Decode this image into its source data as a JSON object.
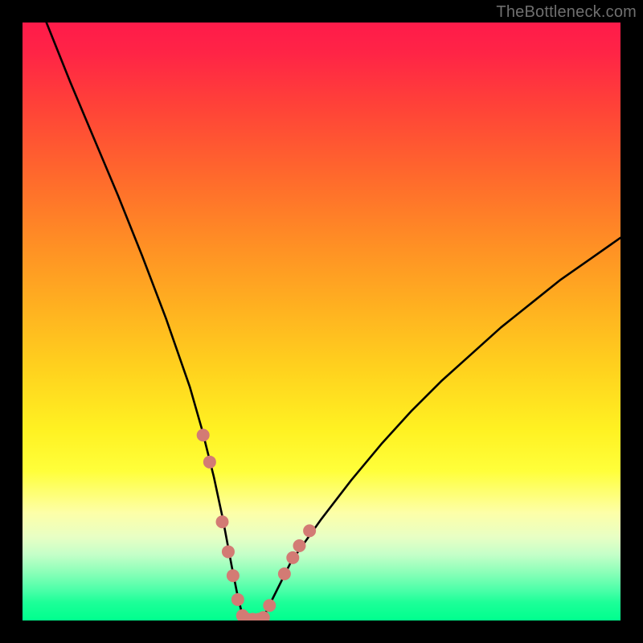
{
  "watermark": "TheBottleneck.com",
  "chart_data": {
    "type": "line",
    "title": "",
    "xlabel": "",
    "ylabel": "",
    "xlim": [
      0,
      100
    ],
    "ylim": [
      0,
      100
    ],
    "background_gradient": {
      "direction": "vertical",
      "stops": [
        {
          "pos": 0.0,
          "color": "#ff1b4a"
        },
        {
          "pos": 0.25,
          "color": "#ff6a2c"
        },
        {
          "pos": 0.5,
          "color": "#ffc01f"
        },
        {
          "pos": 0.7,
          "color": "#fff126"
        },
        {
          "pos": 0.85,
          "color": "#e8ffc4"
        },
        {
          "pos": 1.0,
          "color": "#00ff8e"
        }
      ]
    },
    "series": [
      {
        "name": "bottleneck-curve",
        "color": "#000000",
        "x": [
          4,
          8,
          12,
          16,
          20,
          24,
          28,
          30,
          32,
          33.5,
          35,
          36,
          37,
          38,
          40,
          42,
          45,
          50,
          55,
          60,
          65,
          70,
          75,
          80,
          85,
          90,
          95,
          100
        ],
        "y": [
          100,
          90,
          80.5,
          71,
          61,
          50.5,
          39,
          32,
          24,
          17,
          9,
          4,
          0,
          0,
          0,
          4,
          10,
          17,
          23.5,
          29.5,
          35,
          40,
          44.5,
          49,
          53,
          57,
          60.5,
          64
        ]
      }
    ],
    "markers": {
      "name": "highlight-dots",
      "color": "#d37b74",
      "radius_px": 8,
      "points": [
        {
          "x": 30.2,
          "y": 31.0
        },
        {
          "x": 31.3,
          "y": 26.5
        },
        {
          "x": 33.4,
          "y": 16.5
        },
        {
          "x": 34.4,
          "y": 11.5
        },
        {
          "x": 35.2,
          "y": 7.5
        },
        {
          "x": 36.0,
          "y": 3.5
        },
        {
          "x": 36.8,
          "y": 0.8
        },
        {
          "x": 37.6,
          "y": 0.2
        },
        {
          "x": 38.5,
          "y": 0.2
        },
        {
          "x": 39.5,
          "y": 0.2
        },
        {
          "x": 40.3,
          "y": 0.5
        },
        {
          "x": 41.3,
          "y": 2.5
        },
        {
          "x": 43.8,
          "y": 7.8
        },
        {
          "x": 45.2,
          "y": 10.5
        },
        {
          "x": 46.3,
          "y": 12.5
        },
        {
          "x": 48.0,
          "y": 15.0
        }
      ]
    }
  }
}
